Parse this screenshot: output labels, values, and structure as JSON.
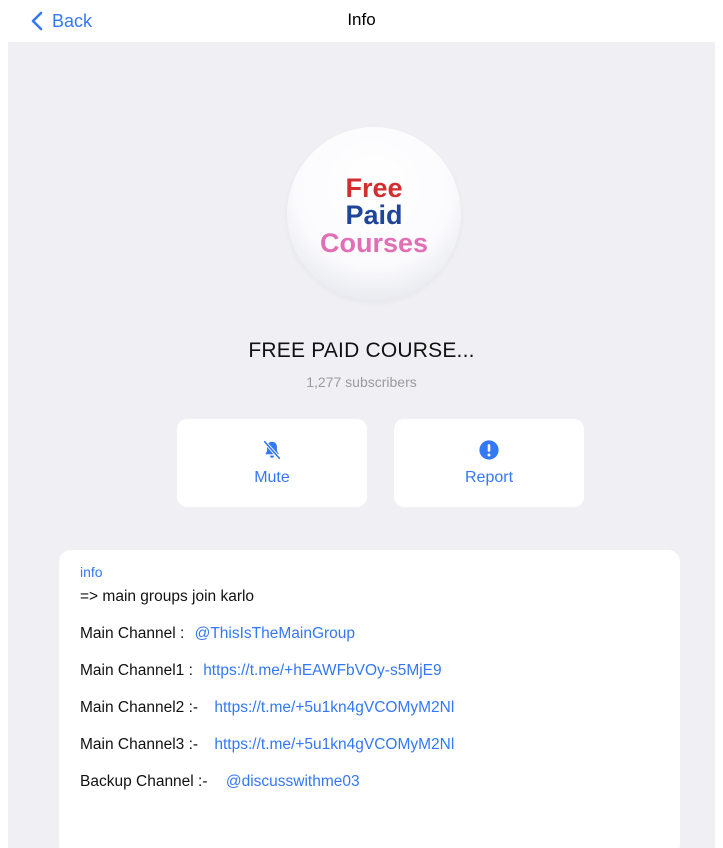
{
  "navbar": {
    "back_label": "Back",
    "title": "Info"
  },
  "channel": {
    "avatar_lines": [
      "Free",
      "Paid",
      "Courses"
    ],
    "name": "FREE PAID COURSE...",
    "subscribers": "1,277 subscribers"
  },
  "actions": {
    "mute_label": "Mute",
    "report_label": "Report"
  },
  "info": {
    "label": "info",
    "intro": "=> main groups join karlo",
    "lines": [
      {
        "key": "Main Channel :",
        "value": "@ThisIsTheMainGroup"
      },
      {
        "key": "Main Channel1 :",
        "value": "https://t.me/+hEAWFbVOy-s5MjE9"
      },
      {
        "key": "Main Channel2  :-",
        "value": "https://t.me/+5u1kn4gVCOMyM2Nl"
      },
      {
        "key": "Main Channel3  :-",
        "value": "https://t.me/+5u1kn4gVCOMyM2Nl"
      },
      {
        "key": "Backup Channel :-",
        "value": "@discusswithme03"
      }
    ]
  },
  "colors": {
    "accent": "#3478f6",
    "background": "#efeff4",
    "avatar_red": "#d12f2f",
    "avatar_blue": "#1f4597",
    "avatar_pink": "#e06fb6"
  }
}
